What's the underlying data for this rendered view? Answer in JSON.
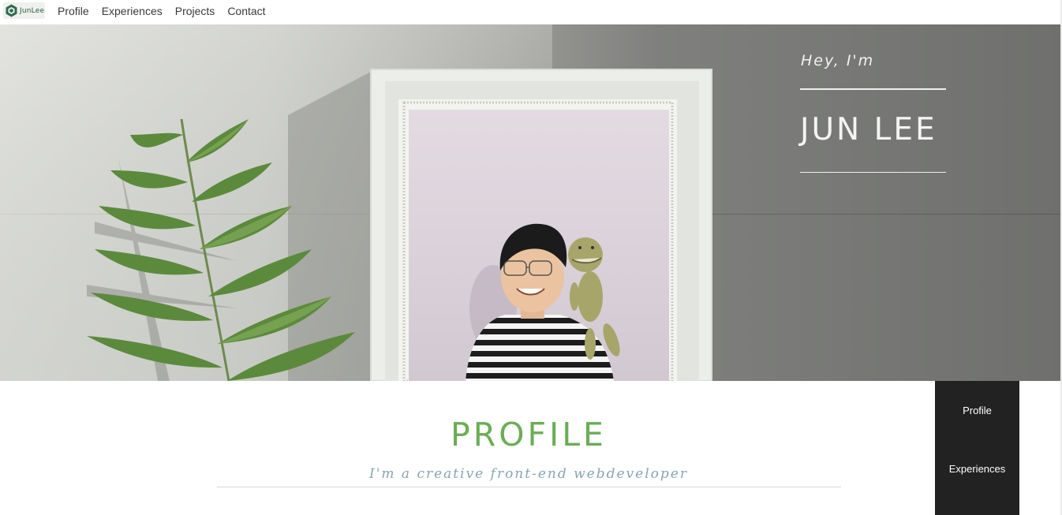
{
  "nav": {
    "logo_text": "JunLee",
    "links": [
      {
        "label": "Profile"
      },
      {
        "label": "Experiences"
      },
      {
        "label": "Projects"
      },
      {
        "label": "Contact"
      }
    ]
  },
  "hero": {
    "greeting": "Hey, I'm",
    "name": "JUN LEE"
  },
  "profile": {
    "title": "PROFILE",
    "subtitle": "I'm a creative front-end webdeveloper"
  },
  "side_menu": {
    "items": [
      {
        "label": "Profile"
      },
      {
        "label": "Experiences"
      }
    ]
  },
  "colors": {
    "accent": "#6aad56",
    "subtitle": "#8aa4b0",
    "side_menu_bg": "#222222"
  }
}
